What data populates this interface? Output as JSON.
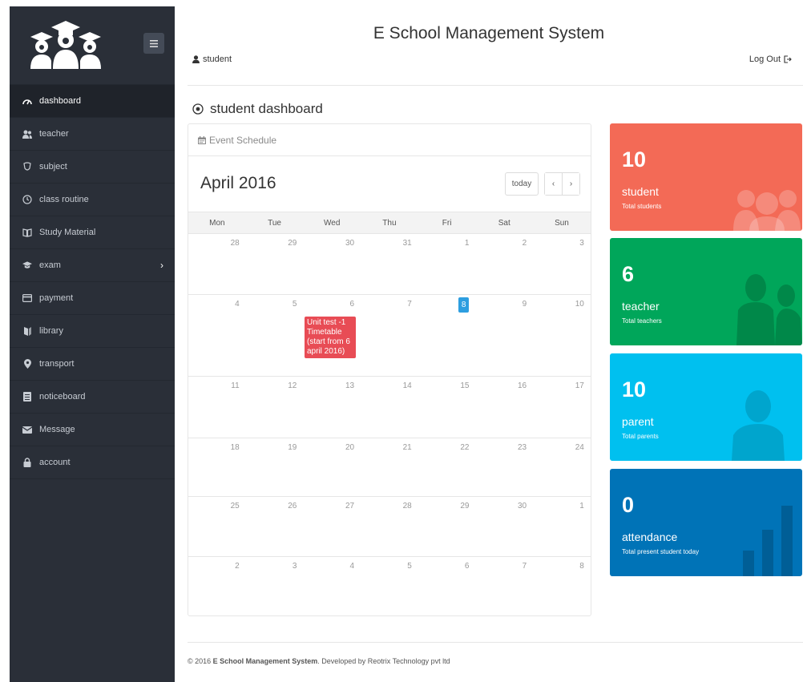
{
  "app": {
    "title": "E School Management System",
    "user": "student",
    "logout": "Log Out"
  },
  "sidebar": {
    "items": [
      {
        "label": "dashboard",
        "icon": "dashboard-icon",
        "active": true
      },
      {
        "label": "teacher",
        "icon": "users-icon"
      },
      {
        "label": "subject",
        "icon": "subject-icon"
      },
      {
        "label": "class routine",
        "icon": "clock-icon"
      },
      {
        "label": "Study Material",
        "icon": "book-icon"
      },
      {
        "label": "exam",
        "icon": "graduation-cap-icon",
        "has_submenu": true
      },
      {
        "label": "payment",
        "icon": "credit-card-icon"
      },
      {
        "label": "library",
        "icon": "library-icon"
      },
      {
        "label": "transport",
        "icon": "map-marker-icon"
      },
      {
        "label": "noticeboard",
        "icon": "notice-icon"
      },
      {
        "label": "Message",
        "icon": "envelope-icon"
      },
      {
        "label": "account",
        "icon": "lock-icon"
      }
    ]
  },
  "page": {
    "title": "student dashboard"
  },
  "calendar": {
    "panel_title": "Event Schedule",
    "month": "April 2016",
    "today_label": "today",
    "prev": "‹",
    "next": "›",
    "weekdays": [
      "Mon",
      "Tue",
      "Wed",
      "Thu",
      "Fri",
      "Sat",
      "Sun"
    ],
    "weeks": [
      [
        "28",
        "29",
        "30",
        "31",
        "1",
        "2",
        "3"
      ],
      [
        "4",
        "5",
        "6",
        "7",
        "8",
        "9",
        "10"
      ],
      [
        "11",
        "12",
        "13",
        "14",
        "15",
        "16",
        "17"
      ],
      [
        "18",
        "19",
        "20",
        "21",
        "22",
        "23",
        "24"
      ],
      [
        "25",
        "26",
        "27",
        "28",
        "29",
        "30",
        "1"
      ],
      [
        "2",
        "3",
        "4",
        "5",
        "6",
        "7",
        "8"
      ]
    ],
    "today": "8",
    "event": {
      "title": "Unit test -1 Timetable (start from 6 april 2016)",
      "lines": [
        "Unit test -1",
        "Timetable",
        "(start from 6",
        "april 2016)"
      ],
      "color": "#e84c55"
    }
  },
  "stats": [
    {
      "value": "10",
      "label": "student",
      "sub": "Total students",
      "color": "#f36a56",
      "icon": "group-icon"
    },
    {
      "value": "6",
      "label": "teacher",
      "sub": "Total teachers",
      "color": "#00a65a",
      "icon": "users-icon"
    },
    {
      "value": "10",
      "label": "parent",
      "sub": "Total parents",
      "color": "#00c0ef",
      "icon": "user-icon"
    },
    {
      "value": "0",
      "label": "attendance",
      "sub": "Total present student today",
      "color": "#0073b7",
      "icon": "bar-chart-icon"
    }
  ],
  "footer": {
    "prefix": "© 2016",
    "brand": "E School Management System",
    "middle": ". Developed by",
    "company": "Reotrix Technology pvt ltd"
  }
}
